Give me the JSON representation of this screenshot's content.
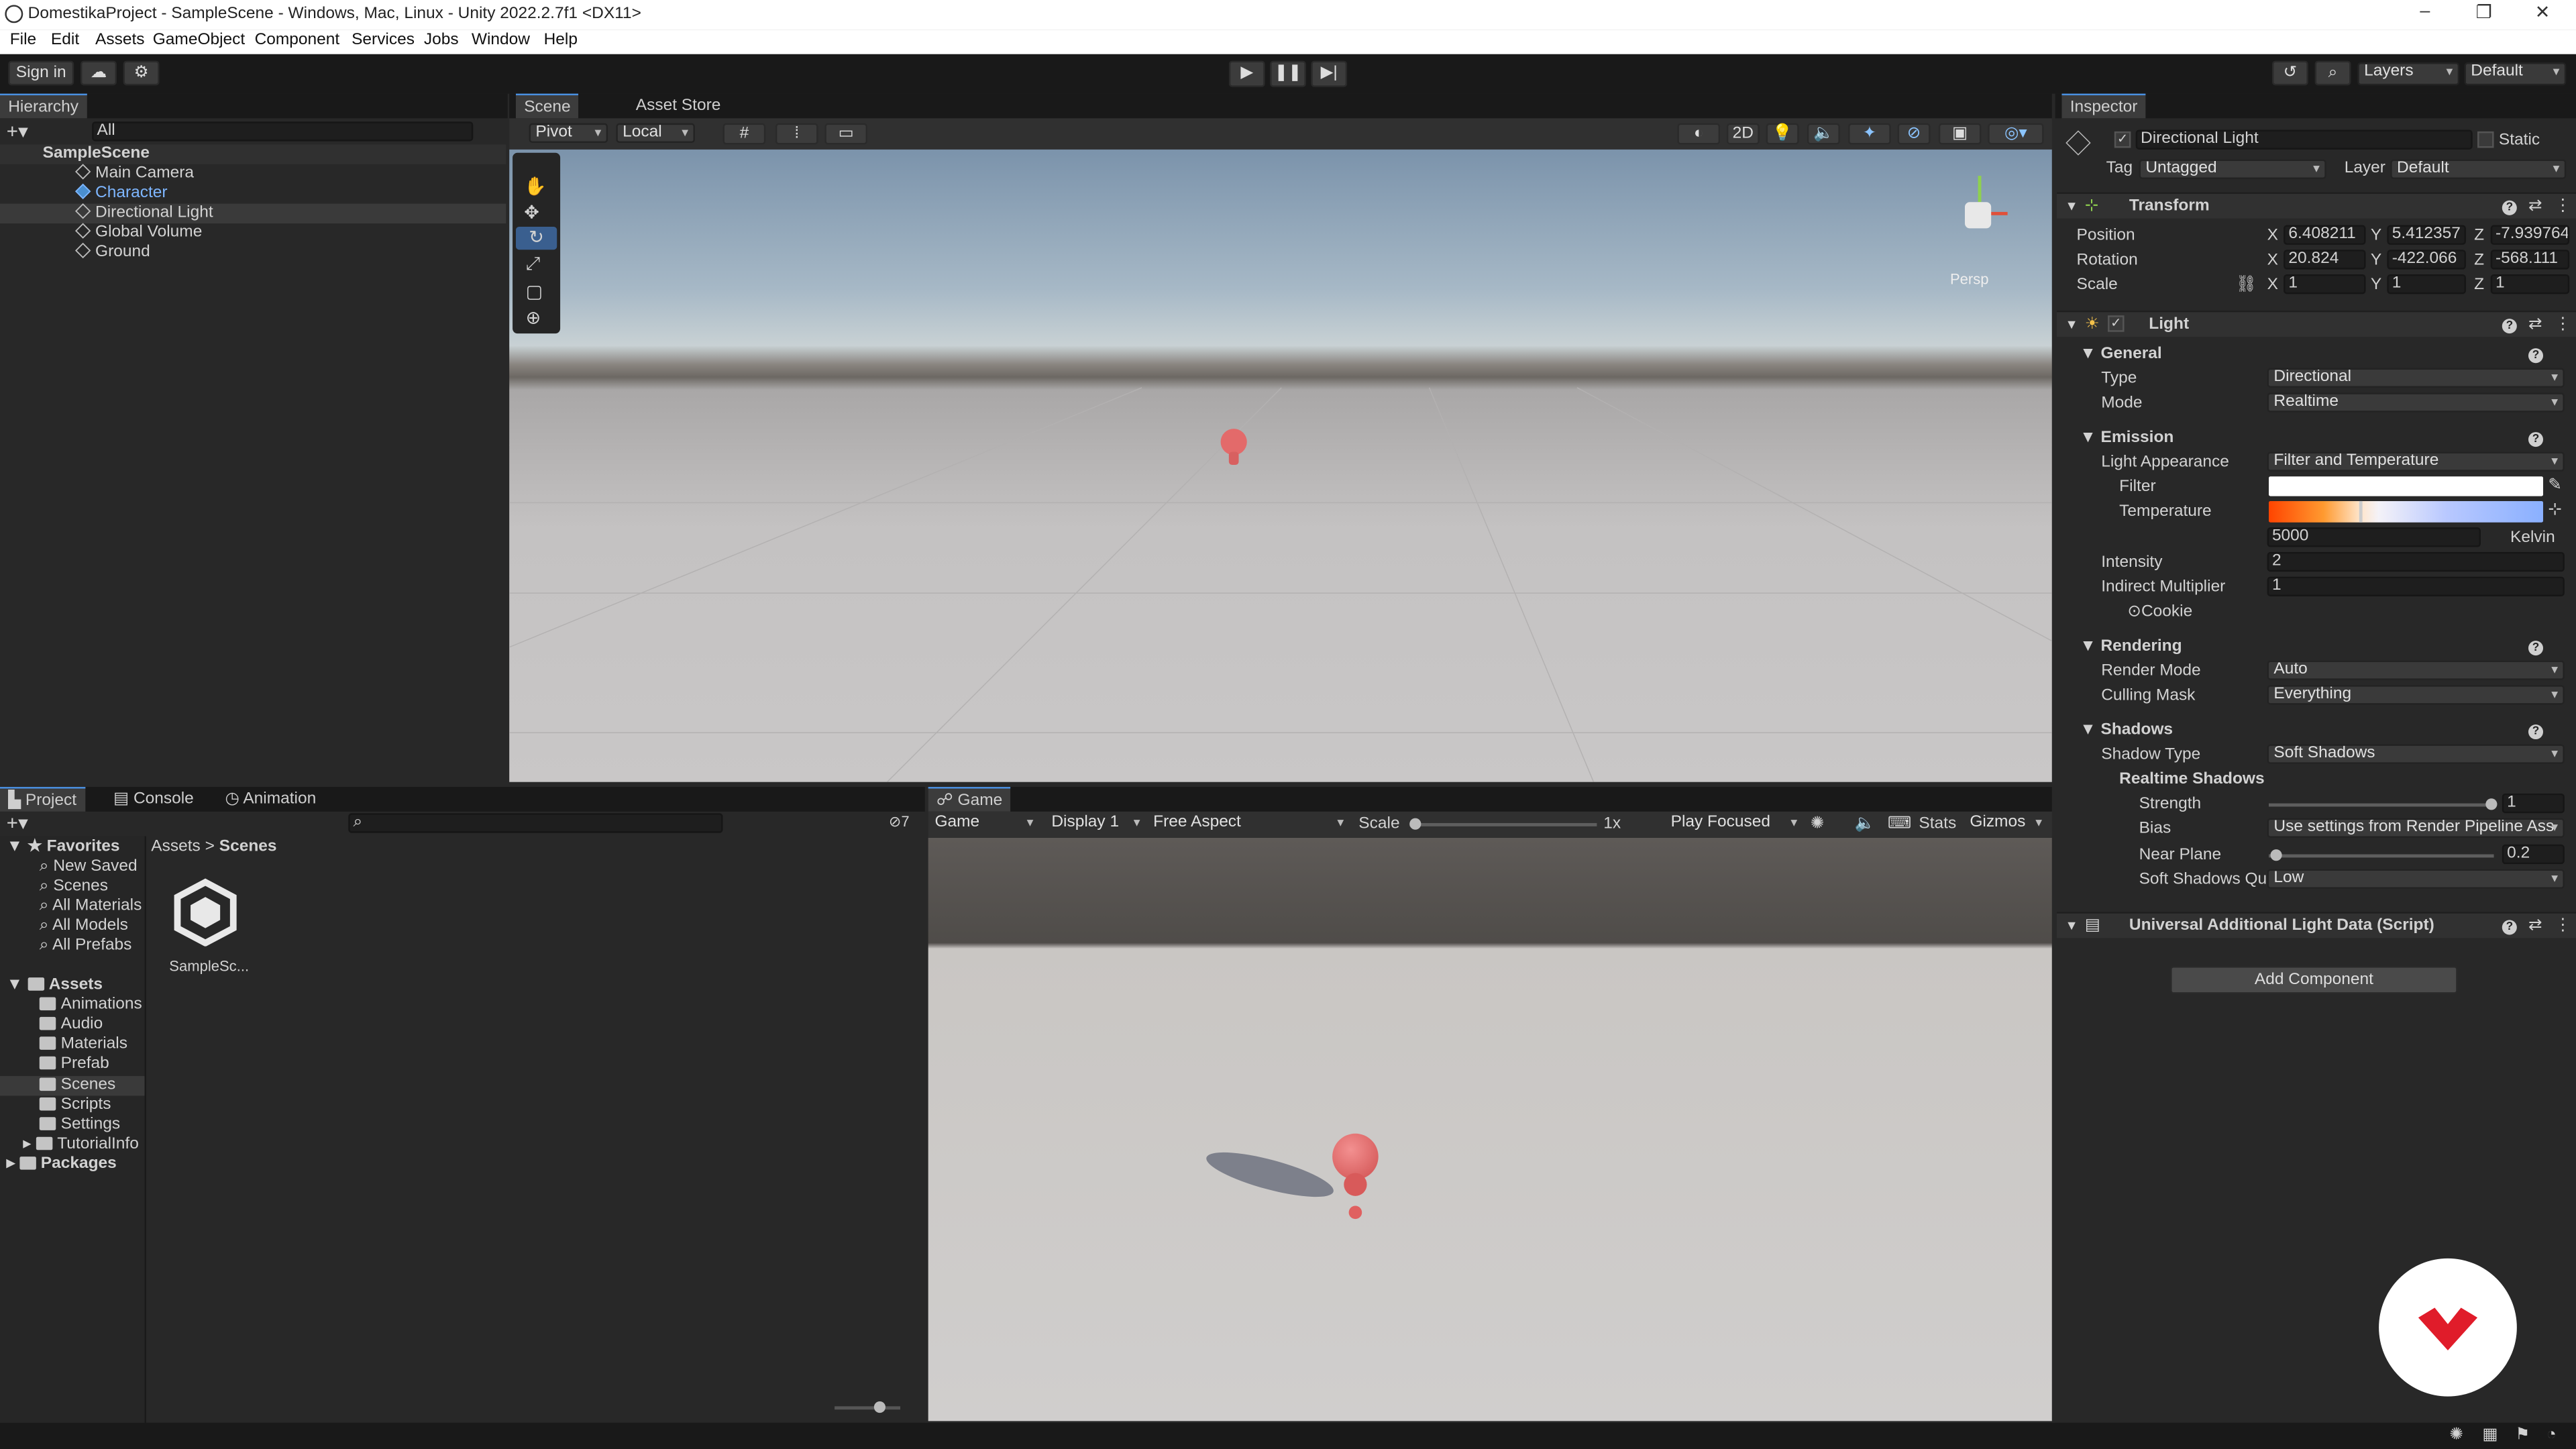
{
  "window": {
    "title": "DomestikaProject - SampleScene - Windows, Mac, Linux - Unity 2022.2.7f1 <DX11>",
    "minimize": "–",
    "maximize": "❐",
    "close": "✕"
  },
  "menu": [
    "File",
    "Edit",
    "Assets",
    "GameObject",
    "Component",
    "Services",
    "Jobs",
    "Window",
    "Help"
  ],
  "toolbar": {
    "sign_in": "Sign in",
    "layers": "Layers",
    "layout": "Default"
  },
  "hierarchy": {
    "tab": "Hierarchy",
    "search_placeholder": "All",
    "scene": "SampleScene",
    "items": [
      "Main Camera",
      "Character",
      "Directional Light",
      "Global Volume",
      "Ground"
    ]
  },
  "scene_view": {
    "tabs": [
      "Scene",
      "Asset Store"
    ],
    "pivot": "Pivot",
    "local": "Local",
    "mode_2d": "2D",
    "persp": "Persp"
  },
  "inspector": {
    "tab": "Inspector",
    "object_name": "Directional Light",
    "static_label": "Static",
    "tag_label": "Tag",
    "tag_value": "Untagged",
    "layer_label": "Layer",
    "layer_value": "Default",
    "transform": {
      "title": "Transform",
      "position_label": "Position",
      "rotation_label": "Rotation",
      "scale_label": "Scale",
      "position": [
        "6.408211",
        "5.412357",
        "-7.939764"
      ],
      "rotation": [
        "20.824",
        "-422.066",
        "-568.111"
      ],
      "scale": [
        "1",
        "1",
        "1"
      ],
      "axes": [
        "X",
        "Y",
        "Z"
      ]
    },
    "light": {
      "title": "Light",
      "general": "General",
      "type_label": "Type",
      "type_value": "Directional",
      "mode_label": "Mode",
      "mode_value": "Realtime",
      "emission": "Emission",
      "appearance_label": "Light Appearance",
      "appearance_value": "Filter and Temperature",
      "filter_label": "Filter",
      "temperature_label": "Temperature",
      "temperature_value": "5000",
      "kelvin": "Kelvin",
      "intensity_label": "Intensity",
      "intensity_value": "2",
      "indirect_label": "Indirect Multiplier",
      "indirect_value": "1",
      "cookie_label": "Cookie",
      "rendering": "Rendering",
      "render_mode_label": "Render Mode",
      "render_mode_value": "Auto",
      "culling_label": "Culling Mask",
      "culling_value": "Everything",
      "shadows": "Shadows",
      "shadow_type_label": "Shadow Type",
      "shadow_type_value": "Soft Shadows",
      "realtime_shadows": "Realtime Shadows",
      "strength_label": "Strength",
      "strength_value": "1",
      "bias_label": "Bias",
      "bias_value": "Use settings from Render Pipeline Ass",
      "near_label": "Near Plane",
      "near_value": "0.2",
      "soft_q_label": "Soft Shadows Qu",
      "soft_q_value": "Low"
    },
    "script": {
      "title": "Universal Additional Light Data (Script)"
    },
    "add_component": "Add Component"
  },
  "project": {
    "tabs": [
      "Project",
      "Console",
      "Animation"
    ],
    "favorites": "Favorites",
    "favorite_items": [
      "New Saved",
      "Scenes",
      "All Materials",
      "All Models",
      "All Prefabs"
    ],
    "assets": "Assets",
    "asset_folders": [
      "Animations",
      "Audio",
      "Materials",
      "Prefab",
      "Scenes",
      "Scripts",
      "Settings",
      "TutorialInfo"
    ],
    "packages": "Packages",
    "breadcrumb": [
      "Assets",
      "Scenes"
    ],
    "asset_file": "SampleSc...",
    "hidden_count": "7"
  },
  "game_view": {
    "tab": "Game",
    "display_mode": "Game",
    "display": "Display 1",
    "aspect": "Free Aspect",
    "scale_label": "Scale",
    "scale_value": "1x",
    "play_mode": "Play Focused",
    "stats": "Stats",
    "gizmos": "Gizmos"
  }
}
